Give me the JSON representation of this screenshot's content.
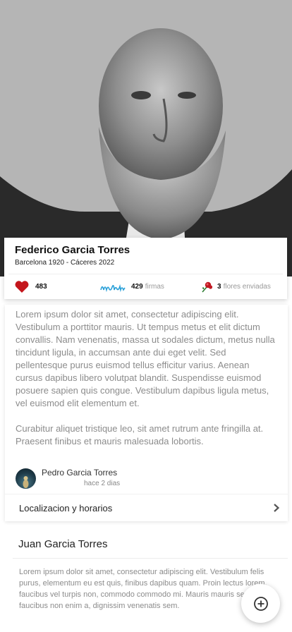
{
  "profile": {
    "name": "Federico Garcia Torres",
    "dates": "Barcelona 1920 -  Cáceres 2022",
    "likes": "483",
    "signatures_count": "429",
    "signatures_label": "firmas",
    "flowers_count": "3",
    "flowers_label": "flores enviadas"
  },
  "comment": {
    "paragraph1": "Lorem ipsum dolor sit amet, consectetur adipiscing elit. Vestibulum a porttitor mauris. Ut tempus metus et elit dictum convallis. Nam venenatis, massa ut sodales dictum, metus nulla tincidunt ligula, in accumsan ante dui eget velit. Sed pellentesque purus euismod tellus efficitur varius. Aenean cursus dapibus libero volutpat blandit. Suspendisse euismod posuere sapien quis congue. Vestibulum dapibus ligula metus, vel euismod elit elementum et.",
    "paragraph2": "Curabitur aliquet tristique leo, sit amet rutrum ante fringilla at. Praesent finibus et mauris malesuada lobortis.",
    "author": "Pedro Garcia Torres",
    "time": "hace 2 dias"
  },
  "location": {
    "label": "Localizacion y horarios"
  },
  "section2": {
    "title": "Juan Garcia Torres",
    "text": "Lorem ipsum dolor sit amet, consectetur adipiscing elit. Vestibulum felis purus, elementum eu est quis, finibus dapibus quam. Proin lectus lorem, faucibus vel turpis non, commodo commodo mi. Mauris mauris sem, faucibus non enim a, dignissim venenatis sem."
  },
  "colors": {
    "heart": "#c4161c",
    "signature": "#2aa0d8",
    "flower": "#c01822"
  },
  "icons": {
    "likes": "heart-icon",
    "signatures": "signature-icon",
    "flowers": "flower-icon",
    "chevron": "chevron-right-icon",
    "fab": "add-circle-icon"
  }
}
